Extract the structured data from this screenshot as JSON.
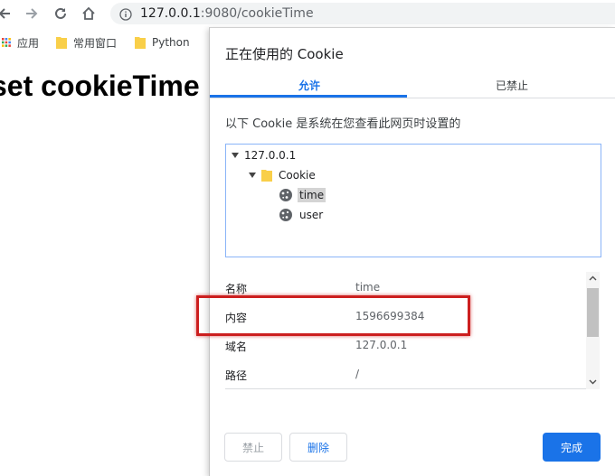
{
  "browser": {
    "url_host": "127.0.0.1",
    "url_path": ":9080/cookieTime",
    "bookmarks": [
      {
        "label": "应用",
        "icon": "apps-grid-icon"
      },
      {
        "label": "常用窗口",
        "icon": "folder-icon"
      },
      {
        "label": "Python",
        "icon": "folder-icon"
      }
    ]
  },
  "page": {
    "heading": "set cookieTime"
  },
  "dialog": {
    "title": "正在使用的 Cookie",
    "tabs": [
      {
        "label": "允许",
        "active": true
      },
      {
        "label": "已禁止",
        "active": false
      }
    ],
    "description": "以下 Cookie 是系统在您查看此网页时设置的",
    "tree": {
      "site": "127.0.0.1",
      "folder": "Cookie",
      "cookies": [
        "time",
        "user"
      ],
      "selected": "time"
    },
    "details": [
      {
        "key": "名称",
        "value": "time"
      },
      {
        "key": "内容",
        "value": "1596699384"
      },
      {
        "key": "域名",
        "value": "127.0.0.1"
      },
      {
        "key": "路径",
        "value": "/"
      }
    ],
    "buttons": {
      "block": "禁止",
      "remove": "删除",
      "done": "完成"
    }
  },
  "colors": {
    "accent": "#1a73e8",
    "highlight": "#cc1f1f"
  }
}
